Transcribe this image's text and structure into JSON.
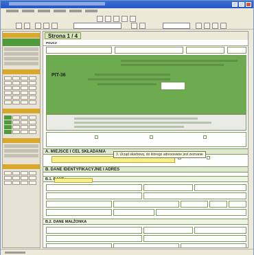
{
  "document": {
    "page_label": "Strona 1 / 4",
    "form_code": "PIT-36",
    "header_label": "POUCZ"
  },
  "sections": {
    "a_title": "A. MIEJSCE I CEL SKŁADANIA",
    "b_title": "B. DANE IDENTYFIKACYJNE I ADRES",
    "b1_title": "B.1. DANE",
    "b2_title": "B.2. DANE MAŁŻONKA"
  },
  "tooltip": {
    "text": "3. Urząd skarbowy, do którego adresowane jest zeznanie"
  },
  "colors": {
    "form_green": "#6cab50",
    "section_header": "#dfe9cf",
    "highlight_yellow": "#f7ef8a",
    "page_tab": "#d9e7bb"
  },
  "icons": {
    "window_close": "close-icon",
    "window_minimize": "minimize-icon",
    "window_maximize": "maximize-icon"
  }
}
